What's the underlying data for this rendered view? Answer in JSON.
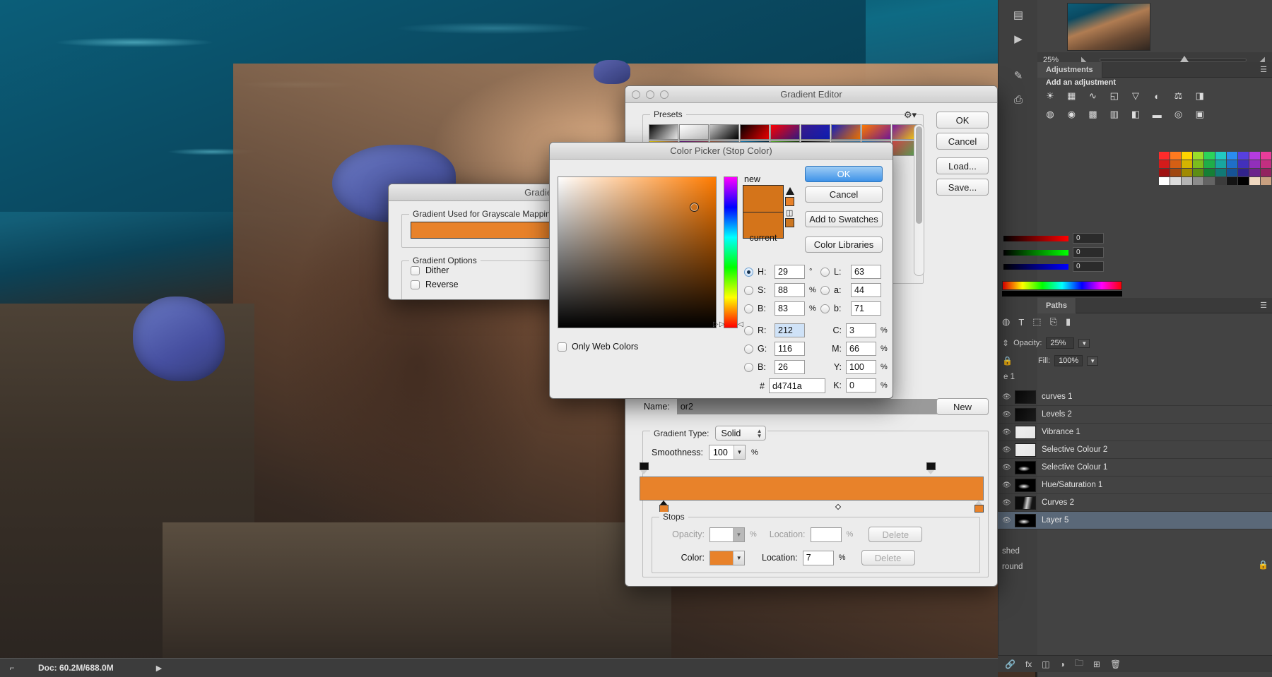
{
  "app": {
    "status_doc": "Doc: 60.2M/688.0M",
    "zoom_level": "25%"
  },
  "panels": {
    "adjustments": {
      "tab_label": "Adjustments",
      "subtitle": "Add an adjustment",
      "icons": [
        "brightness-icon",
        "levels-icon",
        "curves-icon",
        "exposure-icon",
        "vibrance-icon",
        "hue-sat-icon",
        "color-balance-icon",
        "black-white-icon",
        "photo-filter-icon",
        "channel-mixer-icon",
        "invert-icon",
        "posterize-icon",
        "threshold-icon",
        "gradient-map-icon",
        "selective-color-icon"
      ]
    },
    "color": {
      "r": "0",
      "g": "0",
      "b": "0"
    },
    "layers": {
      "tabs": [
        "Paths"
      ],
      "opacity_label": "Opacity:",
      "opacity_value": "25%",
      "fill_label": "Fill:",
      "fill_value": "100%",
      "partial_top_label": "e 1",
      "items": [
        {
          "name": "curves 1",
          "selected": false,
          "thumb": "dark"
        },
        {
          "name": "Levels 2",
          "selected": false,
          "thumb": "dark"
        },
        {
          "name": "Vibrance 1",
          "selected": false,
          "thumb": "white"
        },
        {
          "name": "Selective Colour 2",
          "selected": false,
          "thumb": "white"
        },
        {
          "name": "Selective Colour 1",
          "selected": false,
          "thumb": "mask"
        },
        {
          "name": "Hue/Saturation 1",
          "selected": false,
          "thumb": "mask"
        },
        {
          "name": "Curves 2",
          "selected": false,
          "thumb": "curve"
        },
        {
          "name": "Layer 5",
          "selected": true,
          "thumb": "mask"
        }
      ],
      "partial_rows": [
        "shed",
        "round"
      ]
    }
  },
  "gradient_map": {
    "title": "Gradient Map",
    "section_mapping": "Gradient Used for Grayscale Mapping",
    "section_options": "Gradient Options",
    "dither_label": "Dither",
    "reverse_label": "Reverse",
    "dither_checked": false,
    "reverse_checked": false,
    "gradient_color": "#e8822a"
  },
  "gradient_editor": {
    "title": "Gradient Editor",
    "presets_label": "Presets",
    "gear_icon": "gear-icon",
    "buttons": {
      "ok": "OK",
      "cancel": "Cancel",
      "load": "Load...",
      "save": "Save...",
      "new": "New"
    },
    "name_label": "Name:",
    "name_value": "or2",
    "gradient_type_label": "Gradient Type:",
    "gradient_type_value": "Solid",
    "smoothness_label": "Smoothness:",
    "smoothness_value": "100",
    "smoothness_unit": "%",
    "stops_label": "Stops",
    "opacity_label": "Opacity:",
    "opacity_value": "",
    "opacity_unit": "%",
    "opacity_location_label": "Location:",
    "opacity_location_value": "",
    "opacity_location_unit": "%",
    "opacity_delete": "Delete",
    "color_label": "Color:",
    "color_value": "#e8822a",
    "color_location_label": "Location:",
    "color_location_value": "7",
    "color_location_unit": "%",
    "color_delete": "Delete",
    "preset_row1": [
      "#000000",
      "#ffffff",
      "#cccccc",
      "#000000",
      "#ff0000",
      "#3a1a8c",
      "#1020c0",
      "#ff7a00",
      "#7a1a9c",
      "#ffe000",
      "#6a1a8c",
      "#b06040",
      "#1a90d0"
    ],
    "preset_row2": [
      "#66cc33",
      "#000000",
      "#888888",
      "#2d8bd0",
      "#d84a4a",
      "#44aa55",
      "#c8c8c8",
      "#55bbee",
      "#55bbee",
      "#55bbee",
      "#55bbee",
      "#55bbee",
      "#55bbee"
    ]
  },
  "color_picker": {
    "title": "Color Picker (Stop Color)",
    "buttons": {
      "ok": "OK",
      "cancel": "Cancel",
      "add_to_swatches": "Add to Swatches",
      "color_libraries": "Color Libraries"
    },
    "new_label": "new",
    "current_label": "current",
    "new_color": "#d4741a",
    "current_color": "#d4741a",
    "only_web_colors_label": "Only Web Colors",
    "only_web_colors_checked": false,
    "selected_model": "H",
    "hex_prefix": "#",
    "hex_value": "d4741a",
    "hsb": [
      {
        "key": "H",
        "label": "H:",
        "value": "29",
        "unit": "°",
        "selected": true
      },
      {
        "key": "S",
        "label": "S:",
        "value": "88",
        "unit": "%",
        "selected": false
      },
      {
        "key": "B",
        "label": "B:",
        "value": "83",
        "unit": "%",
        "selected": false
      }
    ],
    "rgb": [
      {
        "key": "R",
        "label": "R:",
        "value": "212",
        "unit": "",
        "selected": false,
        "highlighted": true
      },
      {
        "key": "G",
        "label": "G:",
        "value": "116",
        "unit": "",
        "selected": false,
        "highlighted": false
      },
      {
        "key": "B2",
        "label": "B:",
        "value": "26",
        "unit": "",
        "selected": false,
        "highlighted": false
      }
    ],
    "lab": [
      {
        "key": "L",
        "label": "L:",
        "value": "63",
        "unit": "",
        "selected": false
      },
      {
        "key": "a",
        "label": "a:",
        "value": "44",
        "unit": "",
        "selected": false
      },
      {
        "key": "b",
        "label": "b:",
        "value": "71",
        "unit": "",
        "selected": false
      }
    ],
    "cmyk": [
      {
        "label": "C:",
        "value": "3",
        "unit": "%"
      },
      {
        "label": "M:",
        "value": "66",
        "unit": "%"
      },
      {
        "label": "Y:",
        "value": "100",
        "unit": "%"
      },
      {
        "label": "K:",
        "value": "0",
        "unit": "%"
      }
    ],
    "gamut_warning_icon": "gamut-warning-icon",
    "web_warning_icon": "web-color-warning-icon"
  }
}
